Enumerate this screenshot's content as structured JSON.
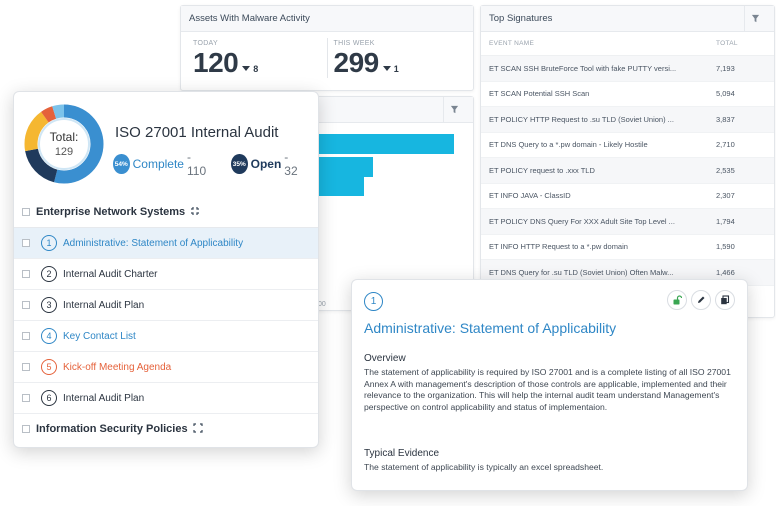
{
  "malware_panel": {
    "title": "Assets With Malware Activity",
    "today_label": "TODAY",
    "today_value": "120",
    "today_delta": "8",
    "week_label": "THIS WEEK",
    "week_value": "299",
    "week_delta": "1"
  },
  "bar_panel": {
    "bars": [
      {
        "fraction": 1.0
      },
      {
        "fraction": 0.4
      },
      {
        "fraction": 0.33
      }
    ],
    "tick_label": "00"
  },
  "signatures": {
    "title": "Top Signatures",
    "col_event": "EVENT NAME",
    "col_total": "TOTAL",
    "rows": [
      {
        "name": "ET SCAN SSH BruteForce Tool with fake PUTTY versi...",
        "total": "7,193"
      },
      {
        "name": "ET SCAN Potential SSH Scan",
        "total": "5,094"
      },
      {
        "name": "ET POLICY HTTP Request to .su TLD (Soviet Union) ...",
        "total": "3,837"
      },
      {
        "name": "ET DNS Query to a *.pw domain - Likely Hostile",
        "total": "2,710"
      },
      {
        "name": "ET POLICY request to .xxx TLD",
        "total": "2,535"
      },
      {
        "name": "ET INFO JAVA - ClassID",
        "total": "2,307"
      },
      {
        "name": "ET POLICY DNS Query For XXX Adult Site Top Level ...",
        "total": "1,794"
      },
      {
        "name": "ET INFO HTTP Request to a *.pw domain",
        "total": "1,590"
      },
      {
        "name": "ET DNS Query for .su TLD (Soviet Union) Often Malw...",
        "total": "1,466"
      }
    ]
  },
  "audit": {
    "donut_label": "Total:",
    "donut_total": "129",
    "title": "ISO 27001 Internal Audit",
    "complete_pct": "54%",
    "complete_label": "Complete",
    "complete_count": "- 110",
    "open_pct": "35%",
    "open_label": "Open",
    "open_count": "- 32",
    "colors": {
      "blue": "#3a8fd0",
      "navy": "#1f3a5c",
      "yellow": "#f5b731",
      "red": "#e5623b",
      "light_blue": "#7cc3ea"
    },
    "donut_segments": [
      {
        "name": "complete",
        "fraction": 0.54,
        "color": "#3a8fd0"
      },
      {
        "name": "open",
        "fraction": 0.18,
        "color": "#1f3a5c"
      },
      {
        "name": "yellow",
        "fraction": 0.18,
        "color": "#f5b731"
      },
      {
        "name": "red",
        "fraction": 0.05,
        "color": "#e5623b"
      },
      {
        "name": "light",
        "fraction": 0.05,
        "color": "#7cc3ea"
      }
    ],
    "section1": "Enterprise Network Systems",
    "items": [
      {
        "num": "1",
        "label": "Administrative: Statement of Applicability"
      },
      {
        "num": "2",
        "label": "Internal Audit Charter"
      },
      {
        "num": "3",
        "label": "Internal Audit Plan"
      },
      {
        "num": "4",
        "label": "Key Contact List"
      },
      {
        "num": "5",
        "label": "Kick-off Meeting Agenda"
      },
      {
        "num": "6",
        "label": "Internal Audit Plan"
      }
    ],
    "section2": "Information Security Policies"
  },
  "detail": {
    "num": "1",
    "title": "Administrative: Statement of Applicability",
    "overview_h": "Overview",
    "overview_p": "The statement of applicability is required by ISO 27001 and is a complete listing of all ISO 27001 Annex A with management's description of those controls are applicable, implemented and their relevance to the organization. This will help the internal audit team understand Management's perspective on control applicability and status of implementaion.",
    "evidence_h": "Typical Evidence",
    "evidence_p": "The statement of applicability is typically an excel spreadsheet."
  }
}
